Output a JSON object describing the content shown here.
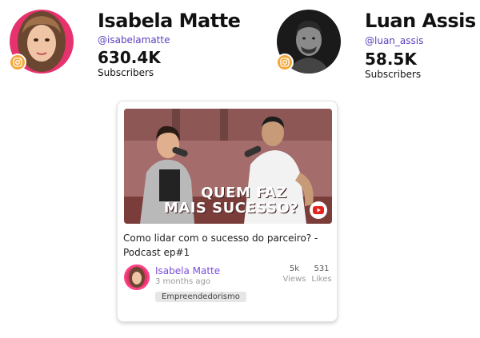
{
  "profiles": [
    {
      "name": "Isabela Matte",
      "handle": "@isabelamatte",
      "subscriber_count": "630.4K",
      "subscribers_label": "Subscribers",
      "platform_icon": "instagram-icon"
    },
    {
      "name": "Luan Assis",
      "handle": "@luan_assis",
      "subscriber_count": "58.5K",
      "subscribers_label": "Subscribers",
      "platform_icon": "instagram-icon"
    }
  ],
  "video_card": {
    "thumbnail_text_line1": "QUEM FAZ",
    "thumbnail_text_line2": "MAIS SUCESSO?",
    "platform_icon": "youtube-icon",
    "title": "Como lidar com o sucesso do parceiro? - Podcast ep#1",
    "author": "Isabela Matte",
    "posted": "3 months ago",
    "views": "5k",
    "views_label": "Views",
    "likes": "531",
    "likes_label": "Likes",
    "tag": "Empreendedorismo"
  },
  "colors": {
    "instagram_badge": "#f4a73a",
    "handle": "#5b3fbf",
    "author": "#7a4dd9",
    "youtube": "#e62117"
  }
}
